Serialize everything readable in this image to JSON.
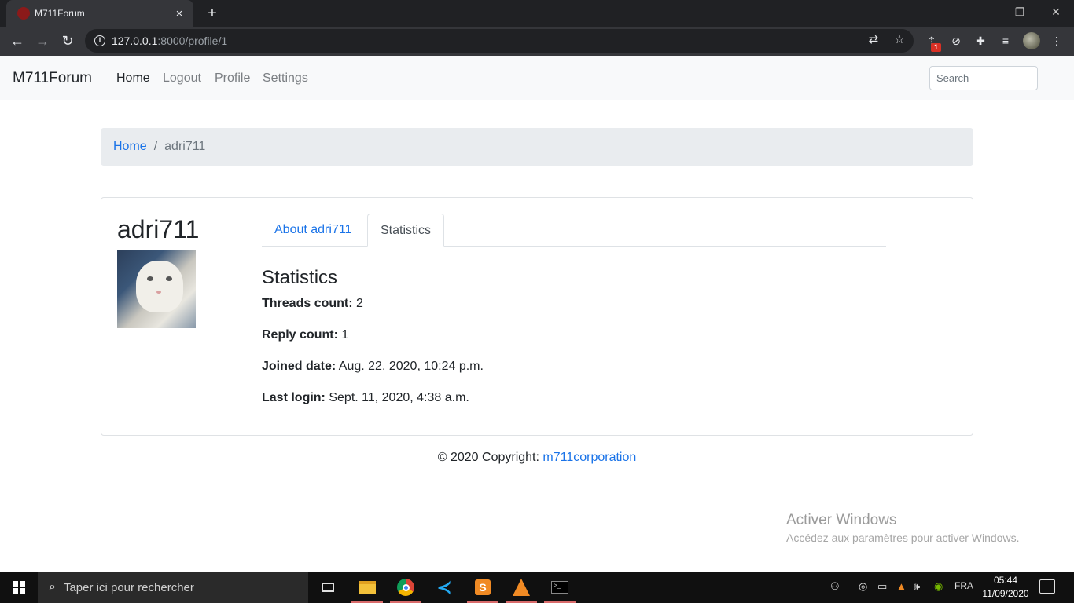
{
  "browser": {
    "tab_title": "M711Forum",
    "tab_close": "×",
    "new_tab": "+",
    "url_host": "127.0.0.1",
    "url_path": ":8000/profile/1",
    "extension_badge": "1",
    "window_controls": [
      "—",
      "❐",
      "✕"
    ]
  },
  "navbar": {
    "brand": "M711Forum",
    "links": [
      "Home",
      "Logout",
      "Profile",
      "Settings"
    ],
    "active_link": "Home",
    "search_placeholder": "Search"
  },
  "breadcrumb": {
    "home": "Home",
    "separator": "/",
    "current": "adri711"
  },
  "profile": {
    "username": "adri711",
    "tabs": [
      "About adri711",
      "Statistics"
    ],
    "active_tab": "Statistics",
    "section_title": "Statistics",
    "stats": [
      {
        "label": "Threads count:",
        "value": "2"
      },
      {
        "label": "Reply count:",
        "value": "1"
      },
      {
        "label": "Joined date:",
        "value": "Aug. 22, 2020, 10:24 p.m."
      },
      {
        "label": "Last login:",
        "value": "Sept. 11, 2020, 4:38 a.m."
      }
    ]
  },
  "footer": {
    "text": "© 2020 Copyright: ",
    "link": "m711corporation"
  },
  "watermark": {
    "title": "Activer Windows",
    "subtitle": "Accédez aux paramètres pour activer Windows."
  },
  "taskbar": {
    "search_placeholder": "Taper ici pour rechercher",
    "language": "FRA",
    "time": "05:44",
    "date": "11/09/2020"
  },
  "colors": {
    "link": "#1a73e8",
    "navbar_bg": "#f8f9fa",
    "breadcrumb_bg": "#e9ecef",
    "taskbar_bg": "#101010"
  }
}
